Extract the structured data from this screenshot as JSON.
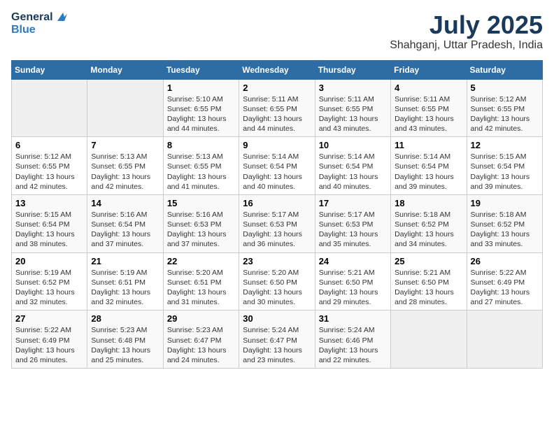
{
  "header": {
    "logo_line1": "General",
    "logo_line2": "Blue",
    "month_year": "July 2025",
    "location": "Shahganj, Uttar Pradesh, India"
  },
  "days_of_week": [
    "Sunday",
    "Monday",
    "Tuesday",
    "Wednesday",
    "Thursday",
    "Friday",
    "Saturday"
  ],
  "weeks": [
    [
      {
        "day": "",
        "info": ""
      },
      {
        "day": "",
        "info": ""
      },
      {
        "day": "1",
        "info": "Sunrise: 5:10 AM\nSunset: 6:55 PM\nDaylight: 13 hours and 44 minutes."
      },
      {
        "day": "2",
        "info": "Sunrise: 5:11 AM\nSunset: 6:55 PM\nDaylight: 13 hours and 44 minutes."
      },
      {
        "day": "3",
        "info": "Sunrise: 5:11 AM\nSunset: 6:55 PM\nDaylight: 13 hours and 43 minutes."
      },
      {
        "day": "4",
        "info": "Sunrise: 5:11 AM\nSunset: 6:55 PM\nDaylight: 13 hours and 43 minutes."
      },
      {
        "day": "5",
        "info": "Sunrise: 5:12 AM\nSunset: 6:55 PM\nDaylight: 13 hours and 42 minutes."
      }
    ],
    [
      {
        "day": "6",
        "info": "Sunrise: 5:12 AM\nSunset: 6:55 PM\nDaylight: 13 hours and 42 minutes."
      },
      {
        "day": "7",
        "info": "Sunrise: 5:13 AM\nSunset: 6:55 PM\nDaylight: 13 hours and 42 minutes."
      },
      {
        "day": "8",
        "info": "Sunrise: 5:13 AM\nSunset: 6:55 PM\nDaylight: 13 hours and 41 minutes."
      },
      {
        "day": "9",
        "info": "Sunrise: 5:14 AM\nSunset: 6:54 PM\nDaylight: 13 hours and 40 minutes."
      },
      {
        "day": "10",
        "info": "Sunrise: 5:14 AM\nSunset: 6:54 PM\nDaylight: 13 hours and 40 minutes."
      },
      {
        "day": "11",
        "info": "Sunrise: 5:14 AM\nSunset: 6:54 PM\nDaylight: 13 hours and 39 minutes."
      },
      {
        "day": "12",
        "info": "Sunrise: 5:15 AM\nSunset: 6:54 PM\nDaylight: 13 hours and 39 minutes."
      }
    ],
    [
      {
        "day": "13",
        "info": "Sunrise: 5:15 AM\nSunset: 6:54 PM\nDaylight: 13 hours and 38 minutes."
      },
      {
        "day": "14",
        "info": "Sunrise: 5:16 AM\nSunset: 6:54 PM\nDaylight: 13 hours and 37 minutes."
      },
      {
        "day": "15",
        "info": "Sunrise: 5:16 AM\nSunset: 6:53 PM\nDaylight: 13 hours and 37 minutes."
      },
      {
        "day": "16",
        "info": "Sunrise: 5:17 AM\nSunset: 6:53 PM\nDaylight: 13 hours and 36 minutes."
      },
      {
        "day": "17",
        "info": "Sunrise: 5:17 AM\nSunset: 6:53 PM\nDaylight: 13 hours and 35 minutes."
      },
      {
        "day": "18",
        "info": "Sunrise: 5:18 AM\nSunset: 6:52 PM\nDaylight: 13 hours and 34 minutes."
      },
      {
        "day": "19",
        "info": "Sunrise: 5:18 AM\nSunset: 6:52 PM\nDaylight: 13 hours and 33 minutes."
      }
    ],
    [
      {
        "day": "20",
        "info": "Sunrise: 5:19 AM\nSunset: 6:52 PM\nDaylight: 13 hours and 32 minutes."
      },
      {
        "day": "21",
        "info": "Sunrise: 5:19 AM\nSunset: 6:51 PM\nDaylight: 13 hours and 32 minutes."
      },
      {
        "day": "22",
        "info": "Sunrise: 5:20 AM\nSunset: 6:51 PM\nDaylight: 13 hours and 31 minutes."
      },
      {
        "day": "23",
        "info": "Sunrise: 5:20 AM\nSunset: 6:50 PM\nDaylight: 13 hours and 30 minutes."
      },
      {
        "day": "24",
        "info": "Sunrise: 5:21 AM\nSunset: 6:50 PM\nDaylight: 13 hours and 29 minutes."
      },
      {
        "day": "25",
        "info": "Sunrise: 5:21 AM\nSunset: 6:50 PM\nDaylight: 13 hours and 28 minutes."
      },
      {
        "day": "26",
        "info": "Sunrise: 5:22 AM\nSunset: 6:49 PM\nDaylight: 13 hours and 27 minutes."
      }
    ],
    [
      {
        "day": "27",
        "info": "Sunrise: 5:22 AM\nSunset: 6:49 PM\nDaylight: 13 hours and 26 minutes."
      },
      {
        "day": "28",
        "info": "Sunrise: 5:23 AM\nSunset: 6:48 PM\nDaylight: 13 hours and 25 minutes."
      },
      {
        "day": "29",
        "info": "Sunrise: 5:23 AM\nSunset: 6:47 PM\nDaylight: 13 hours and 24 minutes."
      },
      {
        "day": "30",
        "info": "Sunrise: 5:24 AM\nSunset: 6:47 PM\nDaylight: 13 hours and 23 minutes."
      },
      {
        "day": "31",
        "info": "Sunrise: 5:24 AM\nSunset: 6:46 PM\nDaylight: 13 hours and 22 minutes."
      },
      {
        "day": "",
        "info": ""
      },
      {
        "day": "",
        "info": ""
      }
    ]
  ]
}
